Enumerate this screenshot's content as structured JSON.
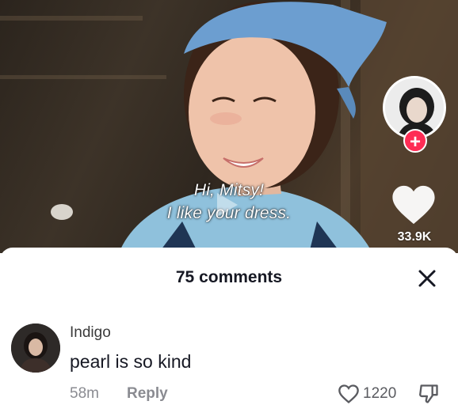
{
  "video": {
    "caption_line1": "Hi, Mitsy!",
    "caption_line2": "I like your dress.",
    "like_count": "33.9K"
  },
  "comments_sheet": {
    "title": "75 comments",
    "comments": [
      {
        "username": "Indigo",
        "text": "pearl is so kind",
        "time": "58m",
        "reply_label": "Reply",
        "like_count": "1220"
      }
    ]
  },
  "colors": {
    "accent": "#fe2c55",
    "text_primary": "#161823",
    "text_secondary": "#8a8b91"
  },
  "icons": {
    "close": "close-icon",
    "like": "heart-icon",
    "dislike": "thumbs-down-icon",
    "follow": "plus-icon"
  }
}
